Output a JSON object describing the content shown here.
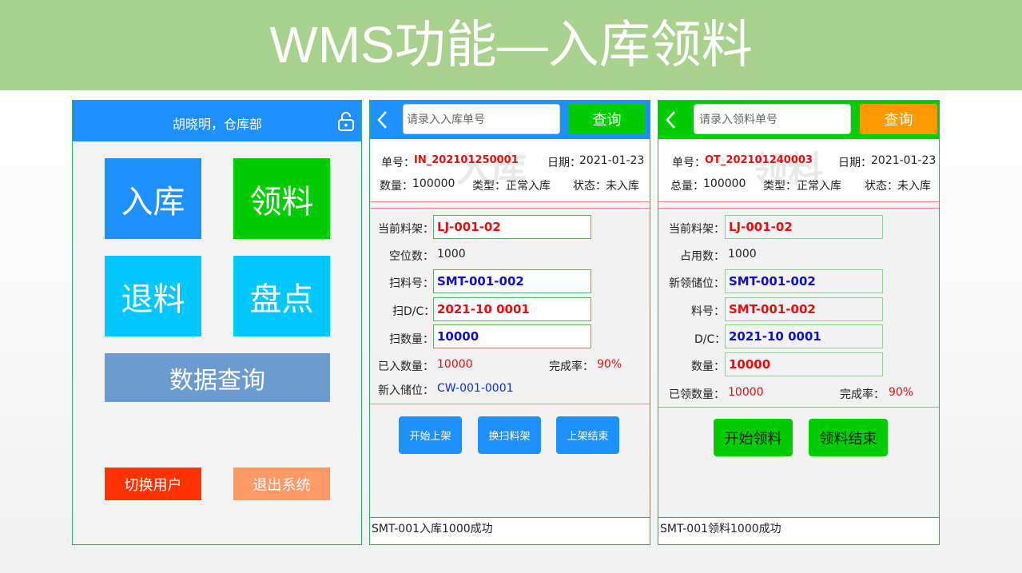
{
  "banner": {
    "title": "WMS功能—入库领料"
  },
  "menu_screen": {
    "user": "胡晓明，仓库部",
    "tiles": {
      "inbound": "入库",
      "picking": "领料",
      "return": "退料",
      "inventory": "盘点",
      "query": "数据查询"
    },
    "switch_user": "切换用户",
    "exit": "退出系统"
  },
  "inbound_screen": {
    "search_placeholder": "请录入入库单号",
    "query_button": "查询",
    "watermark": "入库",
    "order_label": "单号：",
    "order_no": "IN_202101250001",
    "date_label": "日期：",
    "date": "2021-01-23",
    "qty_label": "数量：",
    "qty": "100000",
    "type_label": "类型：",
    "type": "正常入库",
    "status_label": "状态：",
    "status": "未入库",
    "rack_label": "当前料架：",
    "rack": "LJ-001-02",
    "empty_label": "空位数：",
    "empty": "1000",
    "scan_no_label": "扫料号：",
    "scan_no": "SMT-001-002",
    "scan_dc_label": "扫D/C：",
    "scan_dc": "2021-10 0001",
    "scan_qty_label": "扫数量：",
    "scan_qty": "10000",
    "in_qty_label": "已入数量：",
    "in_qty": "10000",
    "rate_label": "完成率：",
    "rate": "90%",
    "new_loc_label": "新入储位：",
    "new_loc": "CW-001-0001",
    "buttons": {
      "start": "开始上架",
      "swap": "换扫料架",
      "finish": "上架结束"
    },
    "status_message": "SMT-001入库1000成功"
  },
  "picking_screen": {
    "search_placeholder": "请录入领料单号",
    "query_button": "查询",
    "watermark": "领料",
    "order_label": "单号：",
    "order_no": "OT_202101240003",
    "date_label": "日期：",
    "date": "2021-01-23",
    "qty_label": "总量：",
    "qty": "100000",
    "type_label": "类型：",
    "type": "正常入库",
    "status_label": "状态：",
    "status": "未入库",
    "rack_label": "当前料架：",
    "rack": "LJ-001-02",
    "used_label": "占用数：",
    "used": "1000",
    "new_loc_label": "新领储位：",
    "new_loc": "SMT-001-002",
    "part_label": "料号：",
    "part": "SMT-001-002",
    "dc_label": "D/C：",
    "dc": "2021-10 0001",
    "count_label": "数量：",
    "count": "10000",
    "picked_label": "已领数量：",
    "picked": "10000",
    "rate_label": "完成率：",
    "rate": "90%",
    "buttons": {
      "start": "开始领料",
      "finish": "领料结束"
    },
    "status_message": "SMT-001领料1000成功"
  }
}
